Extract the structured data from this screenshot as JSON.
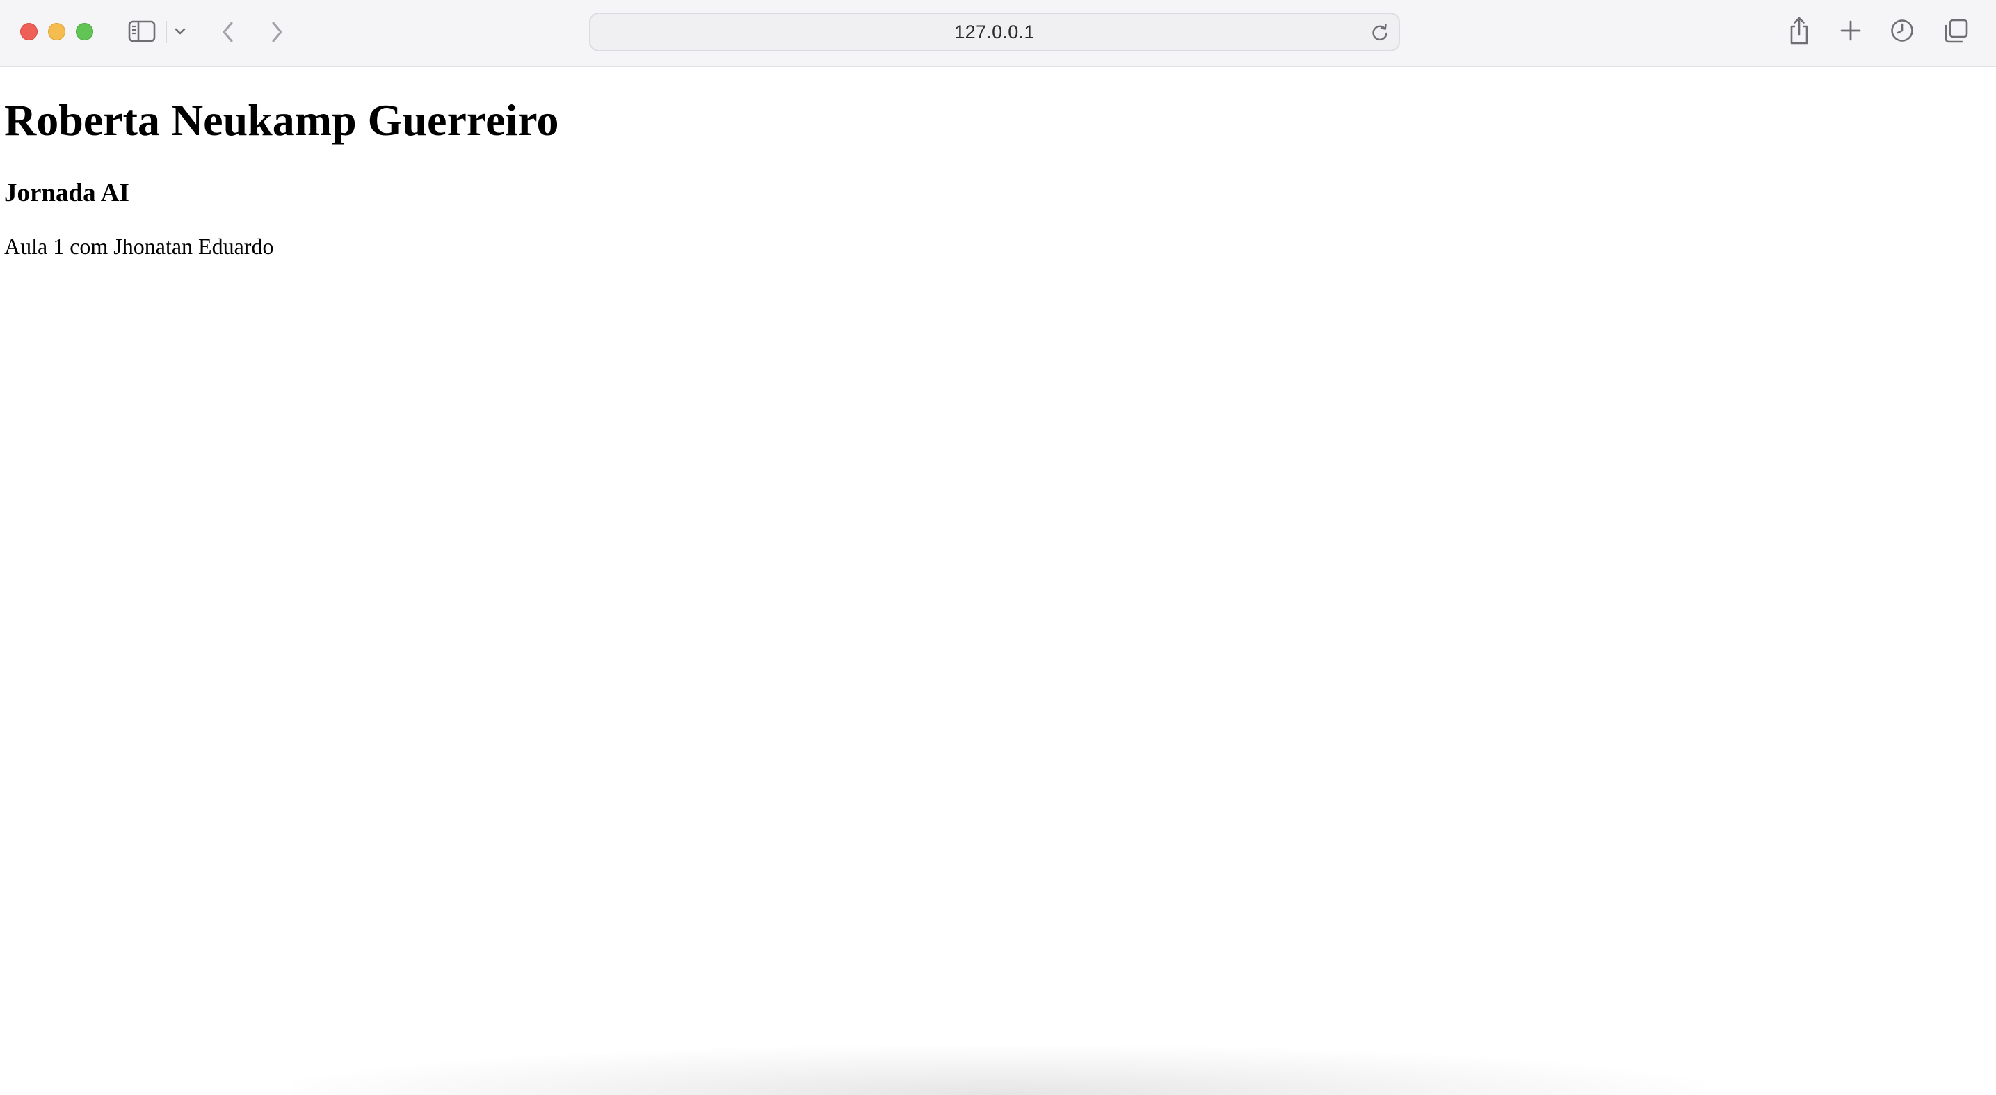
{
  "browser": {
    "address": "127.0.0.1",
    "icons": {
      "close": "close-window-icon",
      "minimize": "minimize-window-icon",
      "maximize": "maximize-window-icon",
      "sidebar": "sidebar-icon",
      "tab_group": "chevron-down-icon",
      "back": "back-arrow-icon",
      "forward": "forward-arrow-icon",
      "reload": "reload-icon",
      "share": "share-icon",
      "new_tab": "plus-icon",
      "history": "clock-icon",
      "tab_overview": "tab-overview-icon"
    },
    "colors": {
      "close": "#ee5f57",
      "minimize": "#f5bd4f",
      "maximize": "#61c454",
      "toolbar": "#f5f5f7"
    }
  },
  "page": {
    "heading": "Roberta Neukamp Guerreiro",
    "subheading": "Jornada AI",
    "paragraph": "Aula 1 com Jhonatan Eduardo"
  }
}
